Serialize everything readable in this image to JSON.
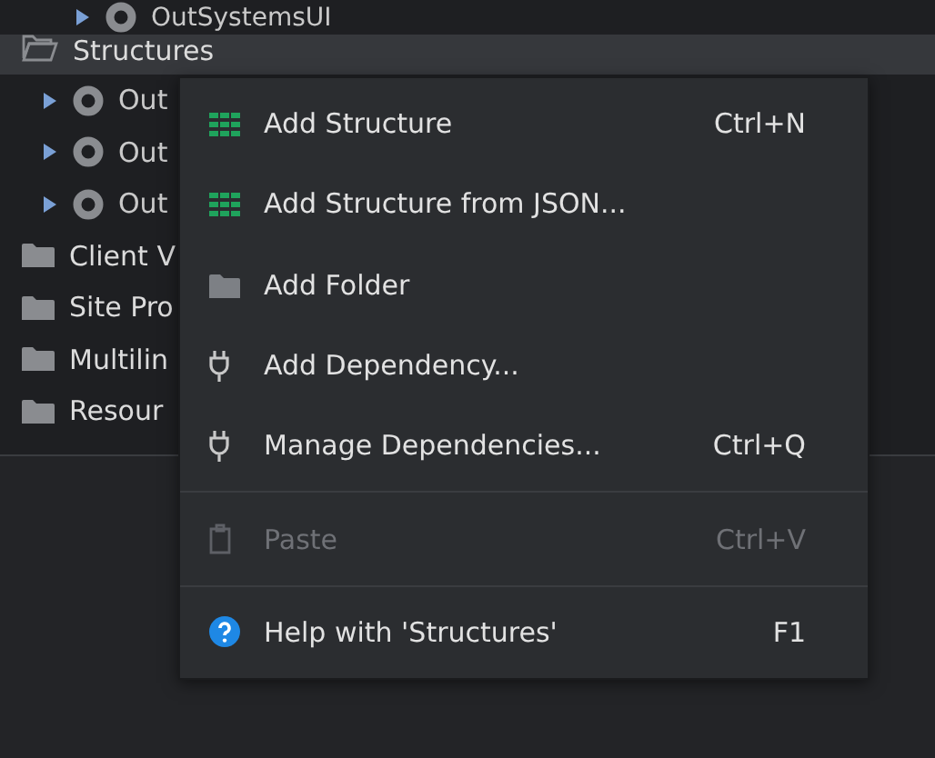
{
  "tree": [
    {
      "label": "OutSystemsUI",
      "kind": "module",
      "selected": false,
      "expanded": false
    },
    {
      "label": "Structures",
      "kind": "folder",
      "selected": true,
      "expanded": true,
      "children": [
        {
          "label": "Out",
          "kind": "module",
          "selected": false,
          "expanded": false
        },
        {
          "label": "Out",
          "kind": "module",
          "selected": false,
          "expanded": false
        },
        {
          "label": "Out",
          "kind": "module",
          "selected": false,
          "expanded": false
        }
      ]
    },
    {
      "label": "Client V",
      "kind": "folder",
      "selected": false,
      "expanded": false
    },
    {
      "label": "Site Pro",
      "kind": "folder",
      "selected": false,
      "expanded": false
    },
    {
      "label": "Multilin",
      "kind": "folder",
      "selected": false,
      "expanded": false
    },
    {
      "label": "Resour",
      "kind": "folder",
      "selected": false,
      "expanded": false
    }
  ],
  "context_menu": {
    "groups": [
      [
        {
          "label": "Add Structure",
          "kind": "grid",
          "shortcut": "Ctrl+N",
          "disabled": false
        },
        {
          "label": "Add Structure from JSON...",
          "kind": "grid",
          "disabled": false
        },
        {
          "label": "Add Folder",
          "kind": "folder",
          "disabled": false
        },
        {
          "label": "Add Dependency...",
          "kind": "plug",
          "disabled": false
        },
        {
          "label": "Manage Dependencies...",
          "kind": "plug",
          "shortcut": "Ctrl+Q",
          "disabled": false
        }
      ],
      [
        {
          "label": "Paste",
          "kind": "clipboard",
          "shortcut": "Ctrl+V",
          "disabled": true
        }
      ],
      [
        {
          "label": "Help with 'Structures'",
          "kind": "help",
          "shortcut": "F1",
          "disabled": false
        }
      ]
    ]
  }
}
